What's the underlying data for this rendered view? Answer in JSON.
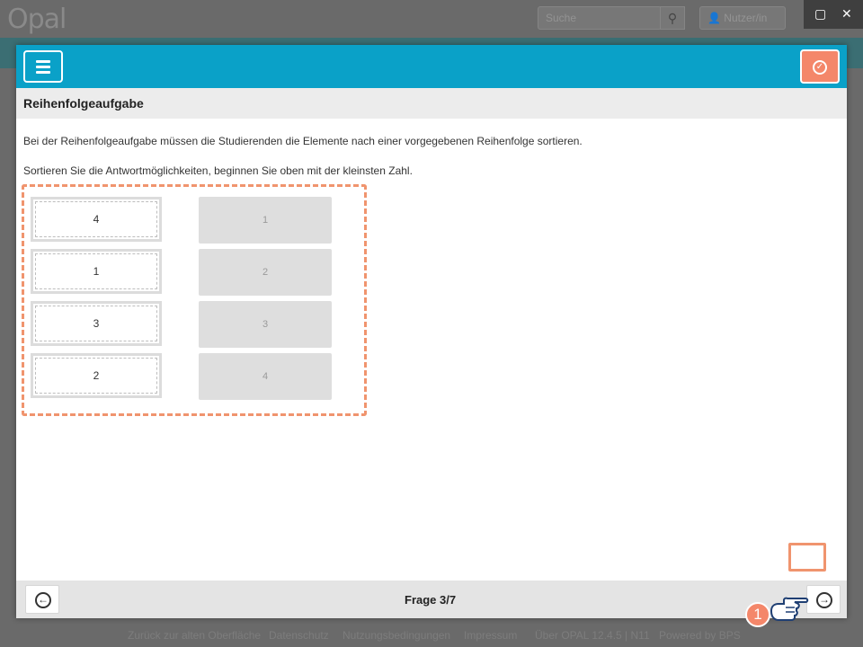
{
  "background": {
    "logo": "Opal",
    "search_placeholder": "Suche",
    "user_menu": "Nutzer/in",
    "footer_links": [
      "Zurück zur alten Oberfläche",
      "Datenschutz",
      "Nutzungsbedingungen",
      "Impressum",
      "Über OPAL 12.4.5 | N11",
      "Powered by BPS"
    ]
  },
  "window": {
    "maximize_icon": "maximize-icon",
    "close_icon": "close-icon"
  },
  "header": {
    "menu_icon": "hamburger-menu-icon",
    "submit_icon": "check-circle-icon"
  },
  "question": {
    "title": "Reihenfolgeaufgabe",
    "text_1": "Bei der Reihenfolgeaufgabe müssen die Studierenden die Elemente nach einer vorgegebenen Reihenfolge sortieren.",
    "text_2": "Sortieren Sie die Antwortmöglichkeiten, beginnen Sie oben mit der kleinsten Zahl."
  },
  "items": [
    "4",
    "1",
    "3",
    "2"
  ],
  "slots": [
    "1",
    "2",
    "3",
    "4"
  ],
  "footer": {
    "page": "Frage 3/7",
    "prev_icon": "arrow-left-circle-icon",
    "next_icon": "arrow-right-circle-icon"
  },
  "annotation": {
    "marker": "1",
    "accent": "#f4876a"
  },
  "colors": {
    "header": "#0aa1c8",
    "accent": "#f0946e"
  }
}
